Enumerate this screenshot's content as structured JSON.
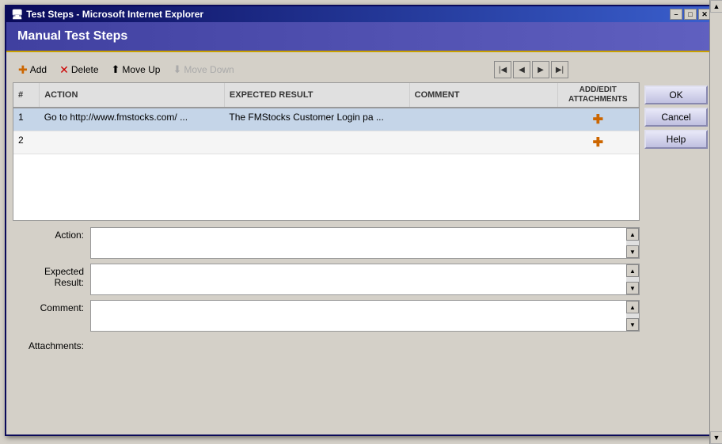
{
  "window": {
    "title": "Test Steps - Microsoft Internet Explorer",
    "header": "Manual Test Steps"
  },
  "titlebar": {
    "minimize": "–",
    "maximize": "□",
    "close": "✕"
  },
  "toolbar": {
    "add_label": "Add",
    "delete_label": "Delete",
    "move_up_label": "Move Up",
    "move_down_label": "Move Down"
  },
  "buttons": {
    "ok": "OK",
    "cancel": "Cancel",
    "help": "Help"
  },
  "table": {
    "columns": {
      "num": "#",
      "action": "ACTION",
      "expected": "EXPECTED RESULT",
      "comment": "COMMENT",
      "attachments": "ADD/EDIT\nATTACHMENTS"
    },
    "rows": [
      {
        "num": 1,
        "action": "Go to http://www.fmstocks.com/ ...",
        "expected": "The FMStocks Customer Login pa ...",
        "comment": "",
        "has_attachment": true
      },
      {
        "num": 2,
        "action": "",
        "expected": "",
        "comment": "",
        "has_attachment": true
      }
    ]
  },
  "form": {
    "action_label": "Action:",
    "expected_label": "Expected Result:",
    "comment_label": "Comment:",
    "attachments_label": "Attachments:"
  }
}
